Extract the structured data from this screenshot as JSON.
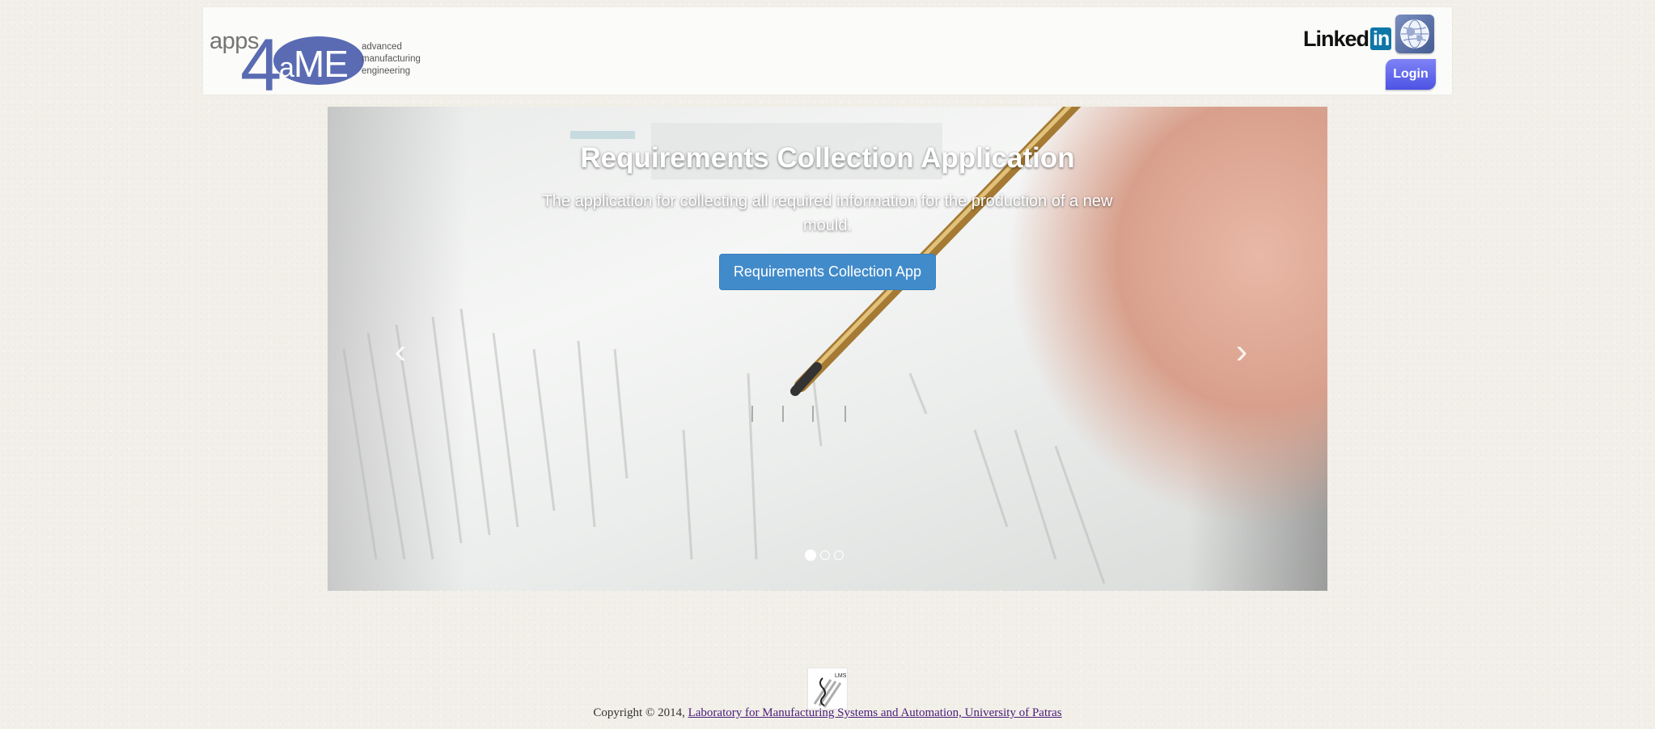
{
  "header": {
    "logo": {
      "apps": "apps",
      "four": "4",
      "a": "a",
      "me": "ME",
      "tagline": [
        "advanced",
        "manufacturing",
        "engineering"
      ]
    },
    "linkedin": {
      "text": "Linked",
      "in": "in"
    },
    "login_label": "Login"
  },
  "carousel": {
    "title": "Requirements Collection Application",
    "description": "The application for collecting all required information for the production of a new mould.",
    "button_label": "Requirements Collection App",
    "prev_glyph": "‹",
    "next_glyph": "›",
    "slide_count": 3,
    "active_slide": 1
  },
  "footer": {
    "logo_text": "LMS",
    "copyright": "Copyright © 2014, ",
    "link_text": "Laboratory for Manufacturing Systems and Automation, University of Patras"
  },
  "colors": {
    "brand": "#5a6bb3",
    "cta": "#428bca",
    "login": "#5b60ea",
    "linkedin": "#0e76a8",
    "footer_link": "#4b1b7a"
  }
}
